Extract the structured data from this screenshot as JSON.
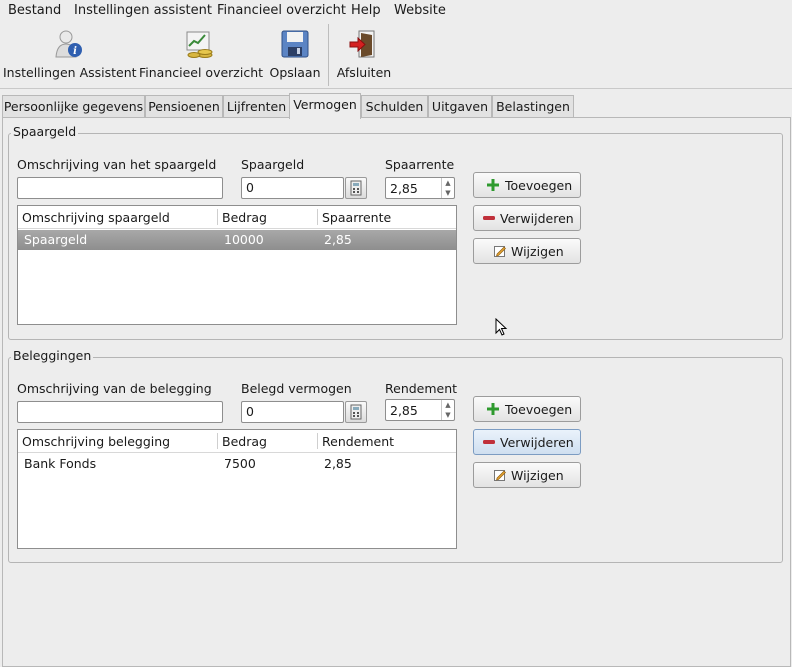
{
  "menu": {
    "items": [
      "Bestand",
      "Instellingen assistent",
      "Financieel overzicht",
      "Help",
      "Website"
    ]
  },
  "toolbar": {
    "buttons": [
      {
        "label": "Instellingen Assistent",
        "icon": "user-info-icon"
      },
      {
        "label": "Financieel overzicht",
        "icon": "finance-chart-icon"
      },
      {
        "label": "Opslaan",
        "icon": "floppy-disk-icon"
      },
      {
        "label": "Afsluiten",
        "icon": "exit-door-icon"
      }
    ]
  },
  "tabs": {
    "items": [
      "Persoonlijke gegevens",
      "Pensioenen",
      "Lijfrenten",
      "Vermogen",
      "Schulden",
      "Uitgaven",
      "Belastingen"
    ],
    "active": "Vermogen"
  },
  "spaargeld": {
    "title": "Spaargeld",
    "desc_label": "Omschrijving van het spaargeld",
    "desc_value": "",
    "amount_label": "Spaargeld",
    "amount_value": "0",
    "rate_label": "Spaarrente",
    "rate_value": "2,85",
    "columns": [
      "Omschrijving spaargeld",
      "Bedrag",
      "Spaarrente"
    ],
    "rows": [
      {
        "desc": "Spaargeld",
        "amount": "10000",
        "rate": "2,85",
        "selected": true
      }
    ],
    "buttons": {
      "add": "Toevoegen",
      "remove": "Verwijderen",
      "edit": "Wijzigen"
    }
  },
  "beleggingen": {
    "title": "Beleggingen",
    "desc_label": "Omschrijving van de belegging",
    "desc_value": "",
    "amount_label": "Belegd vermogen",
    "amount_value": "0",
    "rate_label": "Rendement",
    "rate_value": "2,85",
    "columns": [
      "Omschrijving belegging",
      "Bedrag",
      "Rendement"
    ],
    "rows": [
      {
        "desc": "Bank Fonds",
        "amount": "7500",
        "rate": "2,85",
        "selected": false
      }
    ],
    "buttons": {
      "add": "Toevoegen",
      "remove": "Verwijderen",
      "edit": "Wijzigen"
    }
  },
  "colors": {
    "add": "#2e9a2e",
    "remove": "#c0303a",
    "selection": "#9b9b9b"
  }
}
